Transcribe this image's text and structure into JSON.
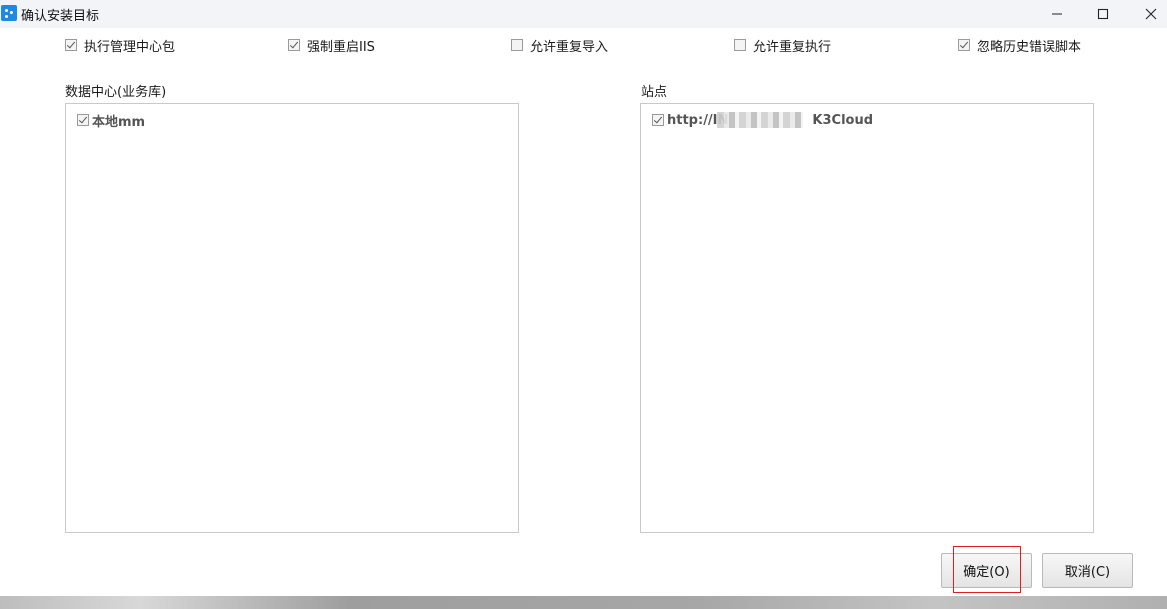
{
  "window": {
    "title": "确认安装目标",
    "controls": [
      "minimize",
      "maximize",
      "close"
    ]
  },
  "options": [
    {
      "label": "执行管理中心包",
      "checked": true
    },
    {
      "label": "强制重启IIS",
      "checked": true
    },
    {
      "label": "允许重复导入",
      "checked": false
    },
    {
      "label": "允许重复执行",
      "checked": false
    },
    {
      "label": "忽略历史错误脚本",
      "checked": true
    }
  ],
  "datacenter": {
    "label": "数据中心(业务库)",
    "items": [
      {
        "label": "本地mm",
        "checked": true
      }
    ]
  },
  "sites": {
    "label": "站点",
    "items": [
      {
        "label": "http://IN",
        "suffix": "K3Cloud",
        "checked": true
      }
    ]
  },
  "buttons": {
    "ok": "确定(O)",
    "cancel": "取消(C)"
  },
  "colors": {
    "highlight": "#e01f1f",
    "app_icon": "#1e88e5"
  }
}
